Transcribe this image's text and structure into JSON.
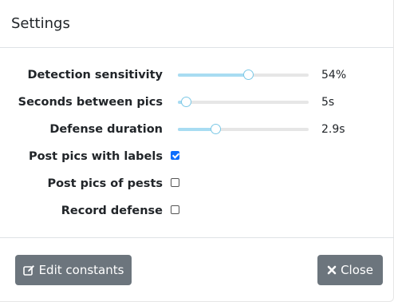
{
  "modal": {
    "title": "Settings"
  },
  "settings": {
    "sliders": [
      {
        "label": "Detection sensitivity",
        "value_text": "54%",
        "fraction": 0.54
      },
      {
        "label": "Seconds between pics",
        "value_text": "5s",
        "fraction": 0.07
      },
      {
        "label": "Defense duration",
        "value_text": "2.9s",
        "fraction": 0.29
      }
    ],
    "checkboxes": [
      {
        "label": "Post pics with labels",
        "checked": true
      },
      {
        "label": "Post pics of pests",
        "checked": false
      },
      {
        "label": "Record defense",
        "checked": false
      }
    ]
  },
  "footer": {
    "edit_label": "Edit constants",
    "edit_icon": "edit-icon",
    "close_label": "Close",
    "close_icon": "x-icon"
  },
  "colors": {
    "button": "#6c757d",
    "slider_fill": "#a8dcf2",
    "slider_thumb_border": "#7cc8e6",
    "checkbox_checked": "#0d6efd"
  }
}
